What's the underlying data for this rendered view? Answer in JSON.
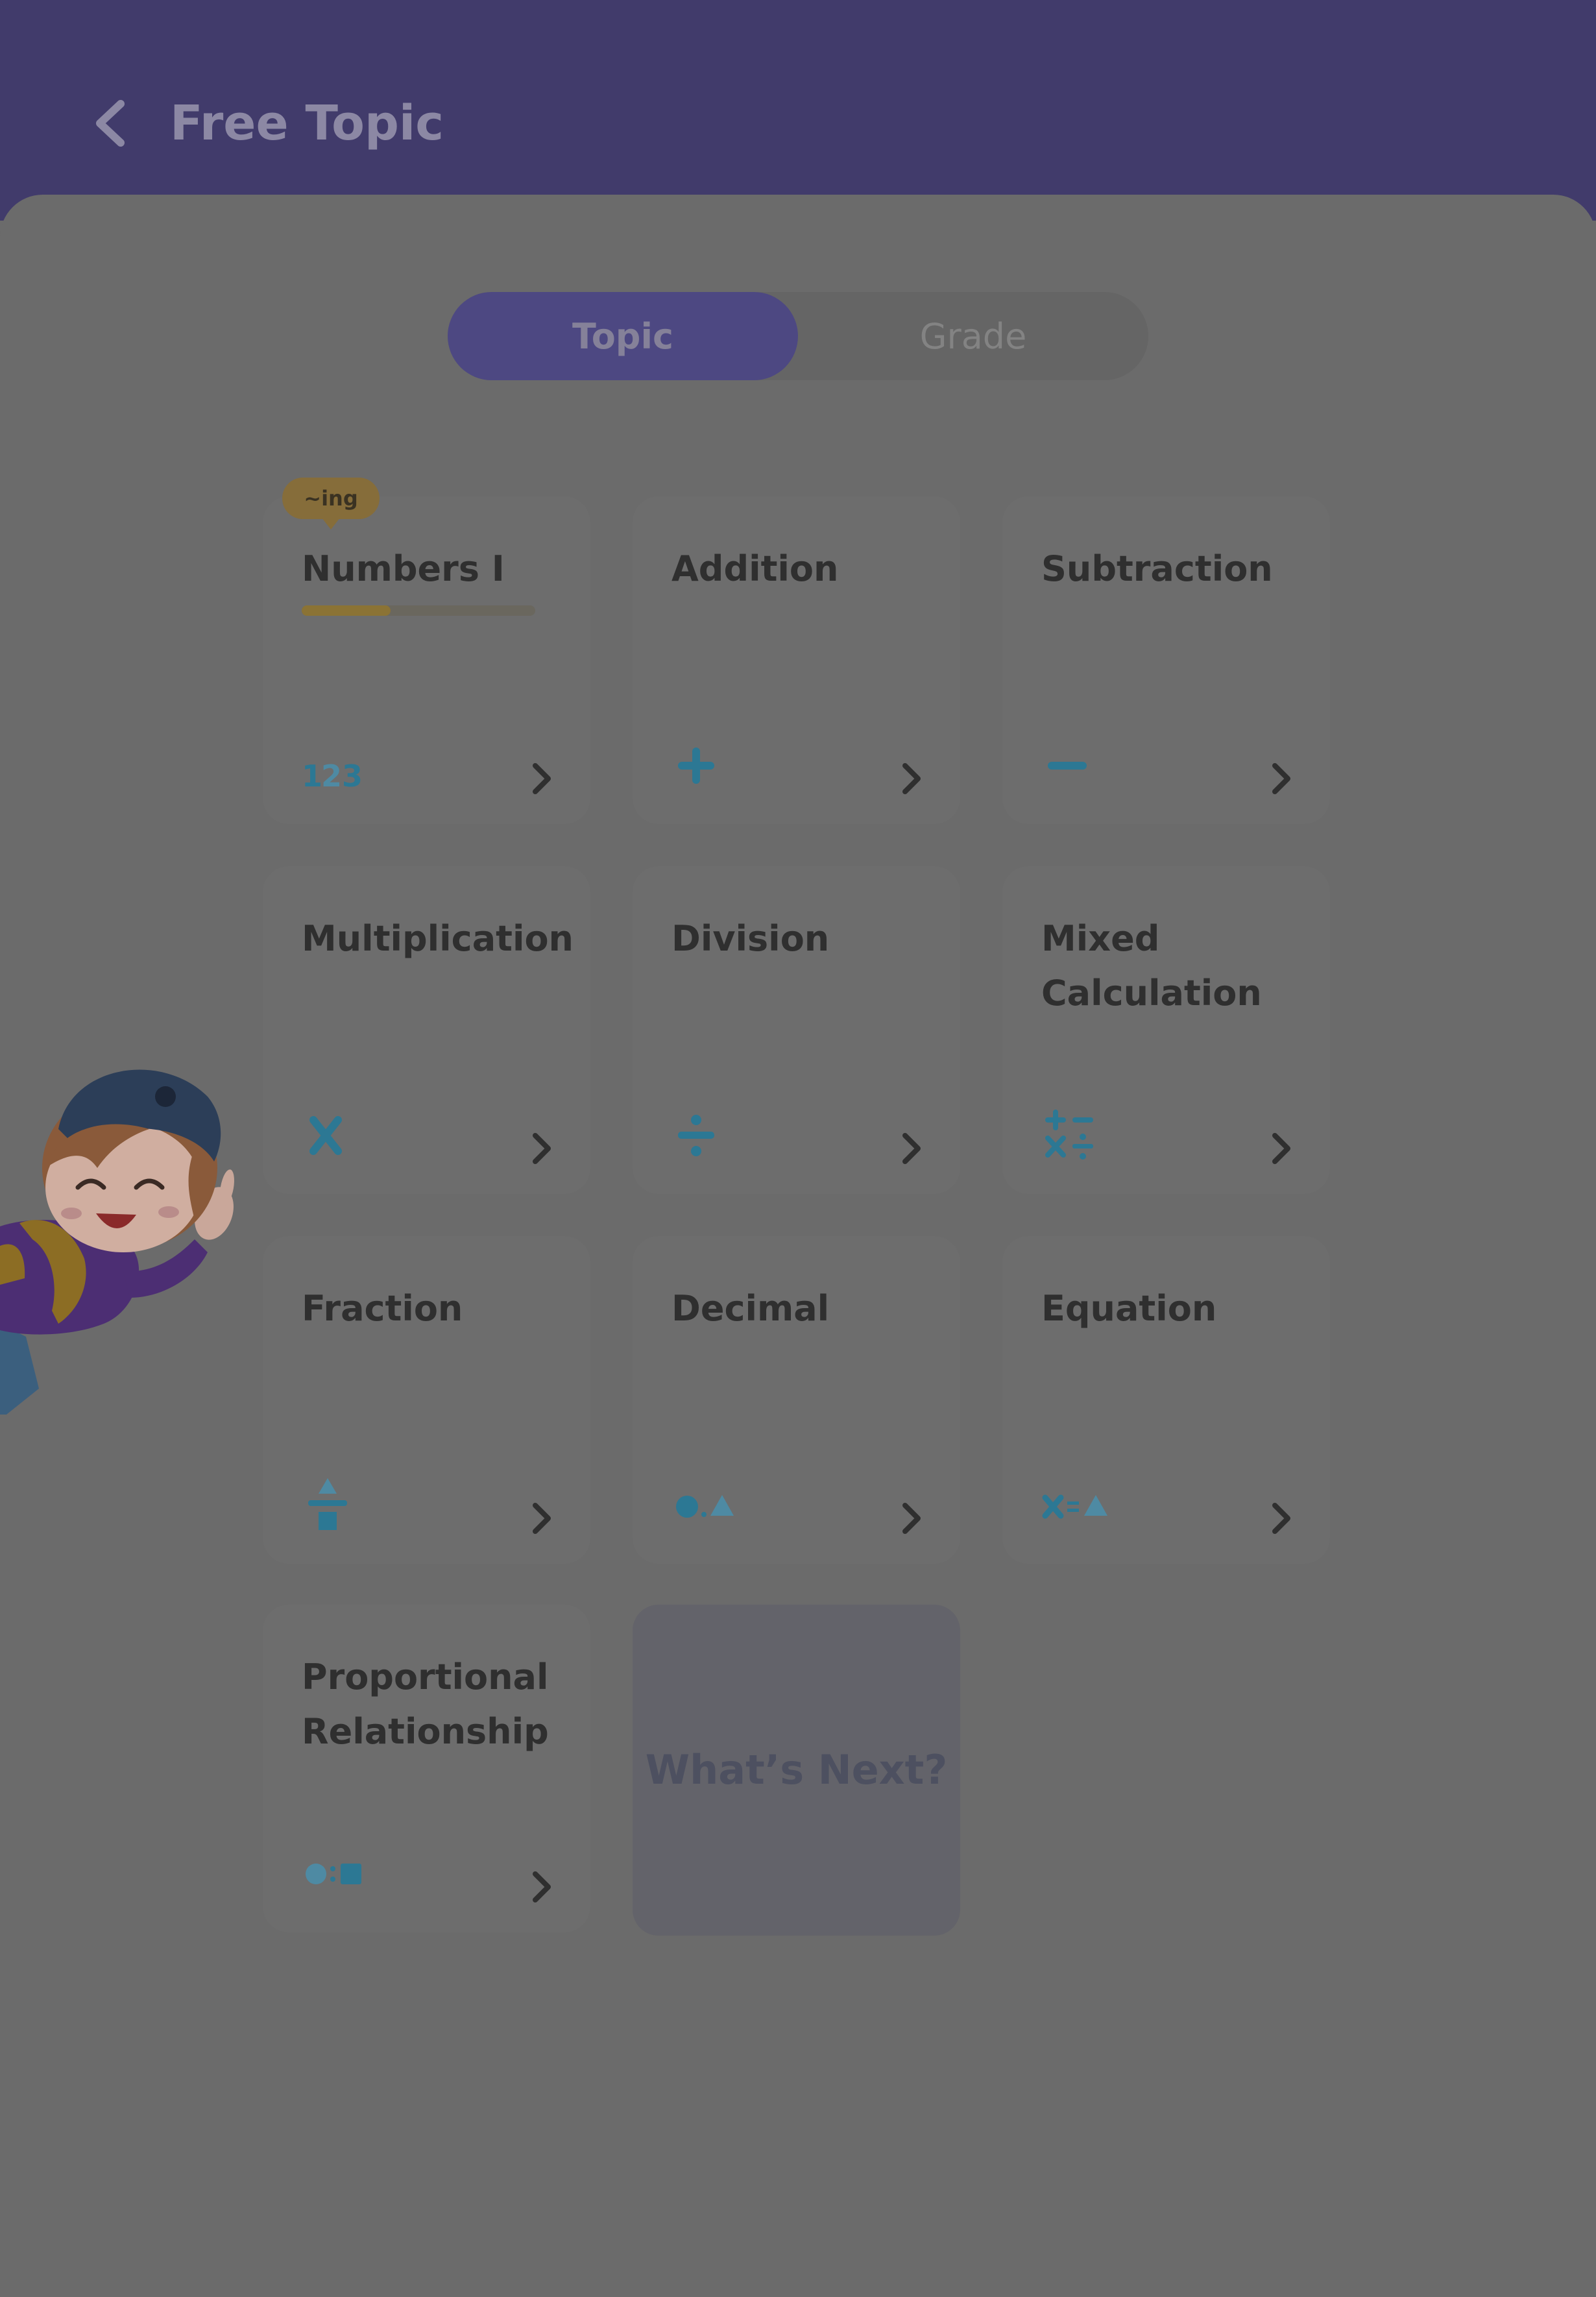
{
  "header": {
    "title": "Free Topic",
    "back_icon": "chevron-left-icon"
  },
  "tabs": [
    {
      "label": "Topic",
      "selected": true
    },
    {
      "label": "Grade",
      "selected": false
    }
  ],
  "cards": [
    {
      "title": "Numbers I",
      "icon": "numbers-123-icon",
      "badge": "~ing",
      "progress": 0.38
    },
    {
      "title": "Addition",
      "icon": "plus-icon"
    },
    {
      "title": "Subtraction",
      "icon": "minus-icon"
    },
    {
      "title": "Multiplication",
      "icon": "times-icon"
    },
    {
      "title": "Division",
      "icon": "divide-icon"
    },
    {
      "title": "Mixed Calculation",
      "icon": "mixed-operations-icon"
    },
    {
      "title": "Fraction",
      "icon": "fraction-icon"
    },
    {
      "title": "Decimal",
      "icon": "decimal-icon"
    },
    {
      "title": "Equation",
      "icon": "equation-icon"
    },
    {
      "title": "Proportional Relationship",
      "icon": "ratio-icon"
    }
  ],
  "whats_next": "What’s Next?",
  "colors": {
    "header": "#413b6b",
    "overlay": "#6b6b6b",
    "tab_selected": "#4d4882",
    "icon": "#2c7894",
    "badge": "#866d3a"
  },
  "mascot": "boy-mascot-illustration"
}
